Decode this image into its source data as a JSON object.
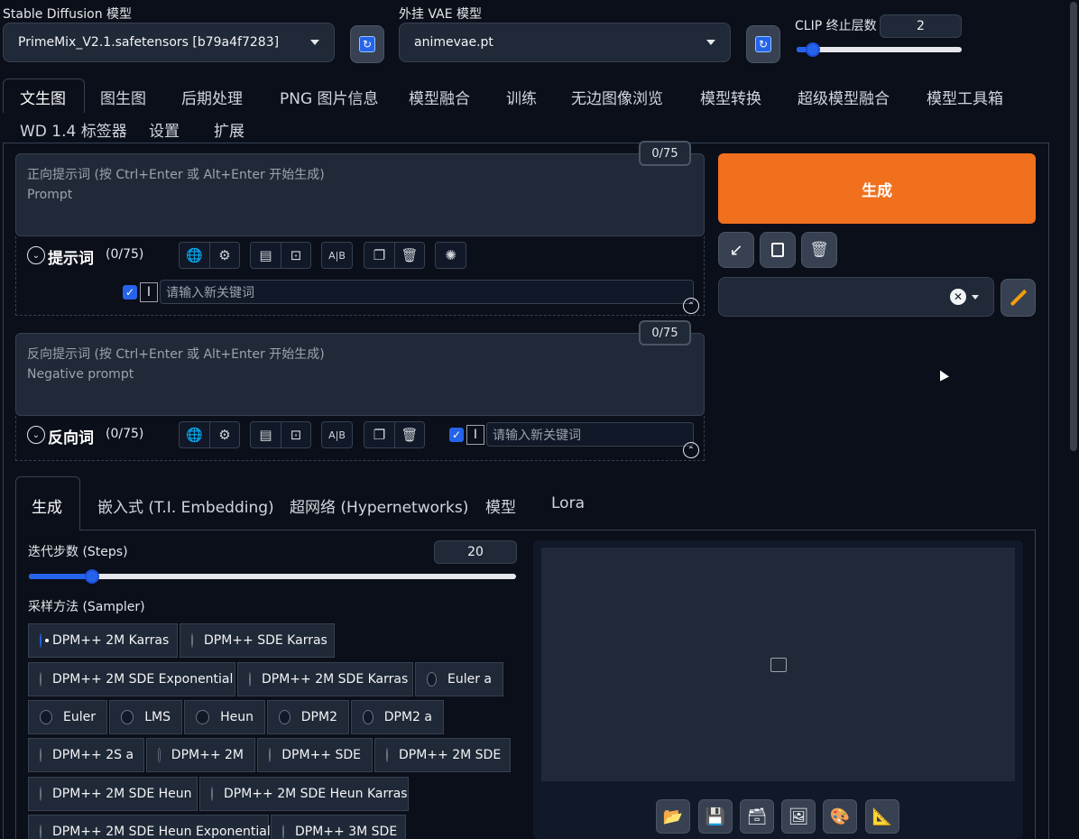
{
  "header": {
    "sd_model_label": "Stable Diffusion 模型",
    "sd_model_value": "PrimeMix_V2.1.safetensors [b79a4f7283]",
    "vae_label": "外挂 VAE 模型",
    "vae_value": "animevae.pt",
    "clip_label": "CLIP 终止层数",
    "clip_value": "2",
    "clip_level": 0.1
  },
  "main_tabs": [
    {
      "label": "文生图"
    },
    {
      "label": "图生图"
    },
    {
      "label": "后期处理"
    },
    {
      "label": "PNG 图片信息"
    },
    {
      "label": "模型融合"
    },
    {
      "label": "训练"
    },
    {
      "label": "无边图像浏览"
    },
    {
      "label": "模型转换"
    },
    {
      "label": "超级模型融合"
    },
    {
      "label": "模型工具箱"
    },
    {
      "label": "WD 1.4 标签器"
    },
    {
      "label": "设置"
    },
    {
      "label": "扩展"
    }
  ],
  "prompt": {
    "counter": "0/75",
    "placeholder_line1": "正向提示词 (按 Ctrl+Enter 或 Alt+Enter 开始生成)",
    "placeholder_line2": "Prompt",
    "section_title": "提示词",
    "section_count": "(0/75)",
    "keyword_placeholder": "请输入新关键词"
  },
  "negative": {
    "counter": "0/75",
    "placeholder_line1": "反向提示词 (按 Ctrl+Enter 或 Alt+Enter 开始生成)",
    "placeholder_line2": "Negative prompt",
    "section_title": "反向词",
    "section_count": "(0/75)",
    "keyword_placeholder": "请输入新关键词"
  },
  "generate": {
    "label": "生成",
    "color": "#f0701e"
  },
  "sub_tabs": [
    {
      "label": "生成"
    },
    {
      "label": "嵌入式 (T.I. Embedding)"
    },
    {
      "label": "超网络 (Hypernetworks)"
    },
    {
      "label": "模型"
    },
    {
      "label": "Lora"
    }
  ],
  "steps": {
    "label": "迭代步数 (Steps)",
    "value": "20",
    "level": 0.13
  },
  "sampler": {
    "label": "采样方法 (Sampler)",
    "options": [
      {
        "label": "DPM++ 2M Karras",
        "selected": true
      },
      {
        "label": "DPM++ SDE Karras"
      },
      {
        "label": "DPM++ 2M SDE Exponential"
      },
      {
        "label": "DPM++ 2M SDE Karras"
      },
      {
        "label": "Euler a"
      },
      {
        "label": "Euler"
      },
      {
        "label": "LMS"
      },
      {
        "label": "Heun"
      },
      {
        "label": "DPM2"
      },
      {
        "label": "DPM2 a"
      },
      {
        "label": "DPM++ 2S a"
      },
      {
        "label": "DPM++ 2M"
      },
      {
        "label": "DPM++ SDE"
      },
      {
        "label": "DPM++ 2M SDE"
      },
      {
        "label": "DPM++ 2M SDE Heun"
      },
      {
        "label": "DPM++ 2M SDE Heun Karras"
      },
      {
        "label": "DPM++ 2M SDE Heun Exponential"
      },
      {
        "label": "DPM++ 3M SDE"
      }
    ]
  },
  "colors": {
    "accent": "#2563eb",
    "background": "#0b0f19",
    "panel": "#1f2937"
  }
}
